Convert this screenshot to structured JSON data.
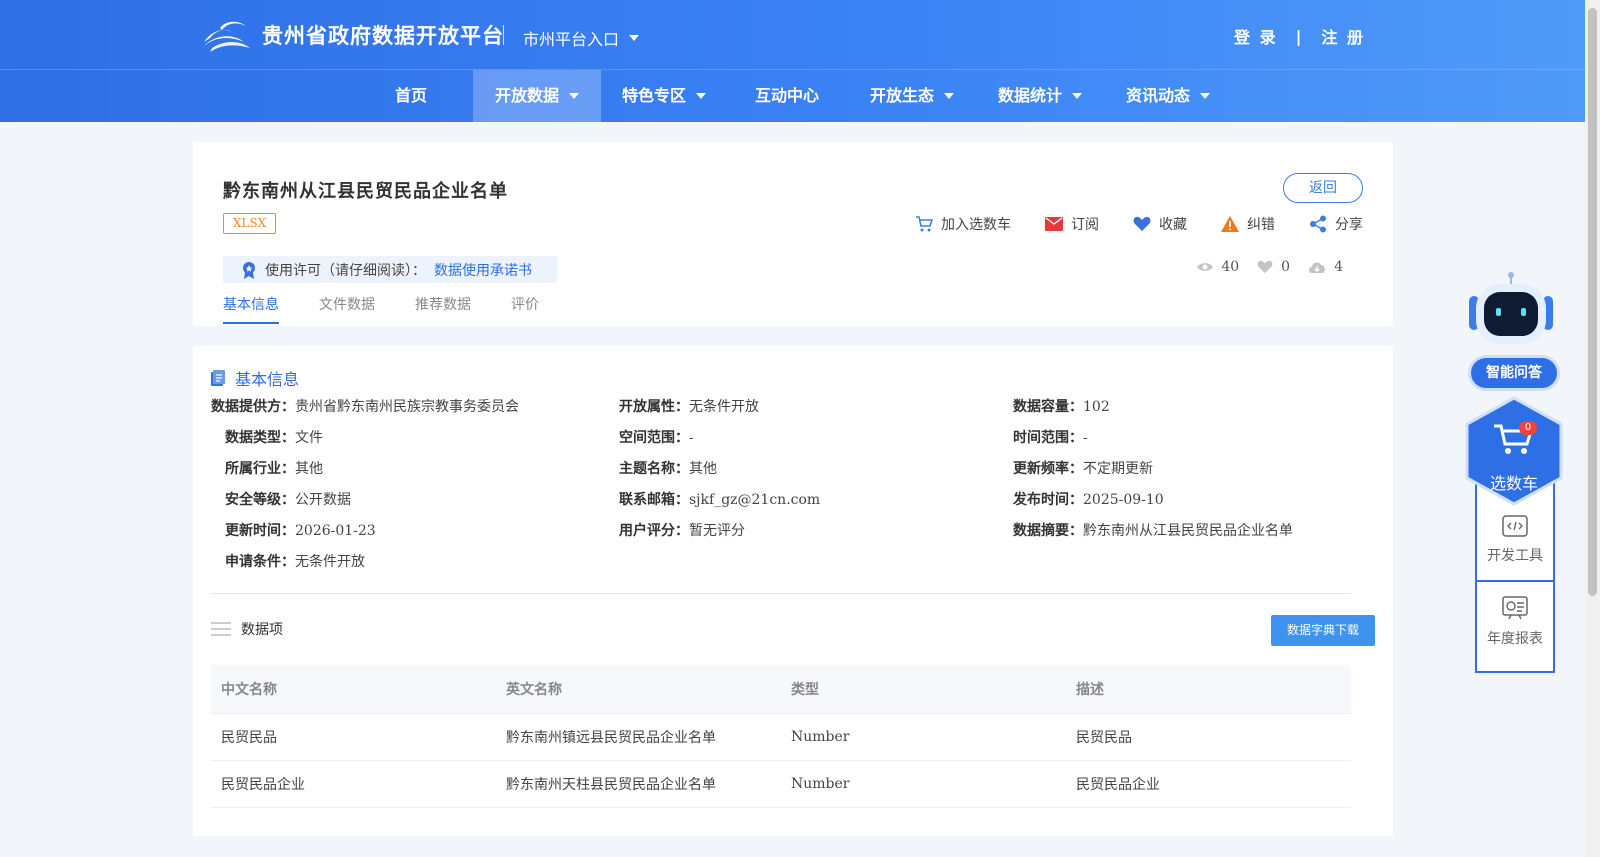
{
  "header": {
    "site_title": "贵州省政府数据开放平台",
    "city_entry": "市州平台入口",
    "login": "登 录",
    "separator": "|",
    "register": "注 册"
  },
  "nav": {
    "items": [
      {
        "label": "首页"
      },
      {
        "label": "开放数据"
      },
      {
        "label": "特色专区"
      },
      {
        "label": "互动中心"
      },
      {
        "label": "开放生态"
      },
      {
        "label": "数据统计"
      },
      {
        "label": "资讯动态"
      }
    ]
  },
  "dataset": {
    "title": "黔东南州从江县民贸民品企业名单",
    "format": "XLSX",
    "back": "返回",
    "actions": {
      "cart": "加入选数车",
      "subscribe": "订阅",
      "favorite": "收藏",
      "report": "纠错",
      "share": "分享"
    },
    "license_label": "使用许可（请仔细阅读）：",
    "license_link": "数据使用承诺书",
    "stats": {
      "views": "40",
      "likes": "0",
      "downloads": "4"
    },
    "tabs": [
      "基本信息",
      "文件数据",
      "推荐数据",
      "评价"
    ]
  },
  "basic_info": {
    "section_title": "基本信息",
    "fields": [
      {
        "label": "数据提供方：",
        "value": "贵州省黔东南州民族宗教事务委员会"
      },
      {
        "label": "开放属性：",
        "value": "无条件开放"
      },
      {
        "label": "数据容量：",
        "value": "102"
      },
      {
        "label": "数据类型：",
        "value": "文件"
      },
      {
        "label": "空间范围：",
        "value": "-"
      },
      {
        "label": "时间范围：",
        "value": "-"
      },
      {
        "label": "所属行业：",
        "value": "其他"
      },
      {
        "label": "主题名称：",
        "value": "其他"
      },
      {
        "label": "更新频率：",
        "value": "不定期更新"
      },
      {
        "label": "安全等级：",
        "value": "公开数据"
      },
      {
        "label": "联系邮箱：",
        "value": "sjkf_gz@21cn.com"
      },
      {
        "label": "发布时间：",
        "value": "2025-09-10"
      },
      {
        "label": "更新时间：",
        "value": "2026-01-23"
      },
      {
        "label": "用户评分：",
        "value": "暂无评分"
      },
      {
        "label": "数据摘要：",
        "value": "黔东南州从江县民贸民品企业名单"
      },
      {
        "label": "申请条件：",
        "value": "无条件开放"
      }
    ]
  },
  "data_items": {
    "title": "数据项",
    "download_button": "数据字典下载",
    "columns": [
      "中文名称",
      "英文名称",
      "类型",
      "描述"
    ],
    "rows": [
      [
        "民贸民品",
        "黔东南州镇远县民贸民品企业名单",
        "Number",
        "民贸民品"
      ],
      [
        "民贸民品企业",
        "黔东南州天柱县民贸民品企业名单",
        "Number",
        "民贸民品企业"
      ]
    ]
  },
  "sidebar": {
    "ai_label": "智能问答",
    "cart_label": "选数车",
    "cart_count": "0",
    "dev_tools": "开发工具",
    "annual_report": "年度报表"
  },
  "colors": {
    "brand": "#2f6fe6",
    "accent_orange": "#f08a24",
    "header_gradient_end": "#4f9bf8"
  }
}
